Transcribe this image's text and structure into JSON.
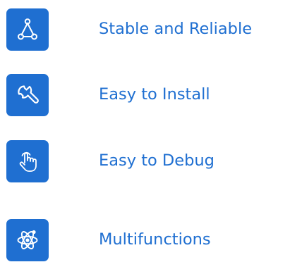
{
  "theme": {
    "accent": "#1f6fd1",
    "icon_fg": "#ffffff",
    "background": "#ffffff"
  },
  "features": [
    {
      "icon": "triangle-nodes-icon",
      "label": "Stable and Reliable"
    },
    {
      "icon": "wrench-icon",
      "label": "Easy to Install"
    },
    {
      "icon": "pointer-hand-icon",
      "label": "Easy to Debug"
    },
    {
      "icon": "atom-icon",
      "label": "Multifunctions"
    }
  ]
}
